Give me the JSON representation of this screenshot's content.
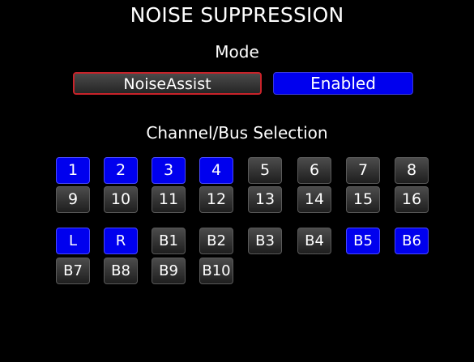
{
  "title": "NOISE SUPPRESSION",
  "mode": {
    "label": "Mode",
    "algorithm_value": "NoiseAssist",
    "state_value": "Enabled"
  },
  "selection": {
    "label": "Channel/Bus Selection",
    "channels": [
      {
        "label": "1",
        "selected": true
      },
      {
        "label": "2",
        "selected": true
      },
      {
        "label": "3",
        "selected": true
      },
      {
        "label": "4",
        "selected": true
      },
      {
        "label": "5",
        "selected": false
      },
      {
        "label": "6",
        "selected": false
      },
      {
        "label": "7",
        "selected": false
      },
      {
        "label": "8",
        "selected": false
      },
      {
        "label": "9",
        "selected": false
      },
      {
        "label": "10",
        "selected": false
      },
      {
        "label": "11",
        "selected": false
      },
      {
        "label": "12",
        "selected": false
      },
      {
        "label": "13",
        "selected": false
      },
      {
        "label": "14",
        "selected": false
      },
      {
        "label": "15",
        "selected": false
      },
      {
        "label": "16",
        "selected": false
      }
    ],
    "buses": [
      {
        "label": "L",
        "selected": true
      },
      {
        "label": "R",
        "selected": true
      },
      {
        "label": "B1",
        "selected": false
      },
      {
        "label": "B2",
        "selected": false
      },
      {
        "label": "B3",
        "selected": false
      },
      {
        "label": "B4",
        "selected": false
      },
      {
        "label": "B5",
        "selected": true
      },
      {
        "label": "B6",
        "selected": true
      },
      {
        "label": "B7",
        "selected": false
      },
      {
        "label": "B8",
        "selected": false
      },
      {
        "label": "B9",
        "selected": false
      },
      {
        "label": "B10",
        "selected": false
      }
    ]
  },
  "colors": {
    "background": "#000000",
    "selected": "#0000ee",
    "unselected": "#333333",
    "focus_border": "#c8232a"
  }
}
